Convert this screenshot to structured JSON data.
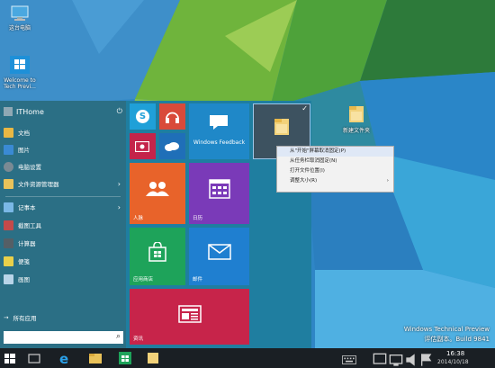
{
  "desktop": {
    "icons": [
      {
        "label": "这台电脑"
      },
      {
        "label": "Welcome to Tech Previ..."
      },
      {
        "label": "新建文件夹"
      }
    ]
  },
  "watermark": {
    "line1": "Windows Technical Preview",
    "line2": "评估副本。Build 9841"
  },
  "start_menu": {
    "user_name": "ITHome",
    "power_glyph": "⏻",
    "items": [
      {
        "label": "文档",
        "icon": "documents-icon",
        "color": "#e9b844"
      },
      {
        "label": "图片",
        "icon": "pictures-icon",
        "color": "#3a8ad4"
      },
      {
        "label": "电脑设置",
        "icon": "gear-icon",
        "color": "#7a8a94"
      },
      {
        "label": "文件资源管理器",
        "icon": "folder-icon",
        "color": "#e9c25a",
        "arrow": "›"
      },
      {
        "label": "记事本",
        "icon": "notepad-icon",
        "color": "#7ab8e6",
        "arrow": "›"
      },
      {
        "label": "截图工具",
        "icon": "snipping-icon",
        "color": "#c44a4a"
      },
      {
        "label": "计算器",
        "icon": "calculator-icon",
        "color": "#555f66"
      },
      {
        "label": "便笺",
        "icon": "sticky-notes-icon",
        "color": "#e9d04a"
      },
      {
        "label": "画图",
        "icon": "paint-icon",
        "color": "#b8d4e8"
      }
    ],
    "all_apps": "所有应用",
    "all_apps_arrow": "→",
    "search_icon": "⌕",
    "tiles": {
      "skype": "S",
      "windows_feedback": "Windows Feedback",
      "folder_check": "✓",
      "people": "人脉",
      "calendar": "日历",
      "store": "应用商店",
      "mail": "邮件",
      "news": "资讯"
    }
  },
  "context_menu": {
    "items": [
      {
        "label": "从\"开始\"屏幕取消固定(P)"
      },
      {
        "label": "从任务栏取消固定(N)"
      },
      {
        "label": "打开文件位置(I)"
      },
      {
        "label": "调整大小(R)",
        "submenu": "›"
      }
    ]
  },
  "taskbar": {
    "time": "16:38",
    "date": "2014/10/18"
  },
  "colors": {
    "start_bg": "#1f7ea0",
    "left_bg": "#2b6f85",
    "skype": "#1fa0d8",
    "music": "#d94a3a",
    "video": "#c4244a",
    "onedrive": "#1f6fb8",
    "feedback": "#1f88c8",
    "people": "#e8632a",
    "calendar": "#7a3ab8",
    "store": "#1ea35a",
    "mail": "#1f7fd0",
    "news": "#c7244a",
    "folder_tile": "#3d5260"
  }
}
